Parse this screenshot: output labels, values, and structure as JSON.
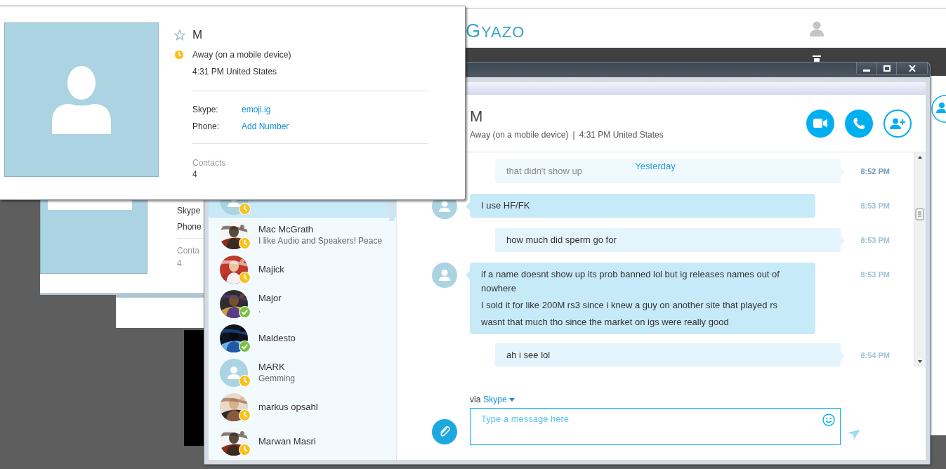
{
  "background_page": {
    "logo": "GYAZO"
  },
  "background_window": {
    "skype_label": "Skype",
    "phone_label": "Phone",
    "contacts_label": "Conta",
    "contacts_count": "4"
  },
  "chat_window": {
    "contacts": [
      {
        "kind": "default",
        "away": true,
        "selected": true
      },
      {
        "name": "Mac McGrath",
        "mood": "I like Audio and Speakers! Peace",
        "away": true,
        "selected": false
      },
      {
        "name": "Majick",
        "away": true,
        "selected": false
      },
      {
        "name": "Major",
        "mood": ".",
        "away": false,
        "selected": false
      },
      {
        "name": "Maldesto",
        "away": false,
        "selected": false
      },
      {
        "kind": "default",
        "name": "MARK",
        "mood": "Gemming",
        "away": true,
        "selected": false
      },
      {
        "name": "markus opsahl",
        "away": true,
        "selected": false
      },
      {
        "name": "Marwan Masri",
        "away": true,
        "selected": false
      }
    ],
    "conversation": {
      "name": "M",
      "status_text": "Away (on a mobile device)",
      "separator": "|",
      "local_time": "4:31 PM United States"
    },
    "day_label": "Yesterday",
    "messages": [
      {
        "kind": "outgoing",
        "faded": true,
        "lines": [
          "that didn't show up"
        ],
        "time": "8:52 PM"
      },
      {
        "kind": "incoming",
        "faded": false,
        "lines": [
          "I use HF/FK"
        ],
        "time": "8:53 PM"
      },
      {
        "kind": "outgoing",
        "faded": false,
        "lines": [
          "how much did sperm go for"
        ],
        "time": "8:53 PM"
      },
      {
        "kind": "incoming",
        "faded": false,
        "lines": [
          "if a name doesnt show up its prob banned lol but ig releases names out of nowhere",
          "I sold it for like 200M rs3 since i knew a guy on another site that played rs",
          "wasnt that much tho since the market on igs were really good"
        ],
        "time": "8:53 PM"
      },
      {
        "kind": "outgoing",
        "faded": false,
        "lines": [
          "ah i see lol"
        ],
        "time": "8:54 PM"
      }
    ],
    "composer": {
      "via": "via",
      "service": "Skype",
      "placeholder": "Type a message here"
    }
  },
  "profile_card": {
    "name": "M",
    "favorite": false,
    "away": true,
    "status_text": "Away (on a mobile device)",
    "local_time": "4:31 PM United States",
    "fields": [
      {
        "label": "Skype:",
        "value": "emoji.ig"
      },
      {
        "label": "Phone:",
        "value": "Add Number"
      }
    ],
    "contacts_label": "Contacts",
    "contacts_count": "4"
  }
}
